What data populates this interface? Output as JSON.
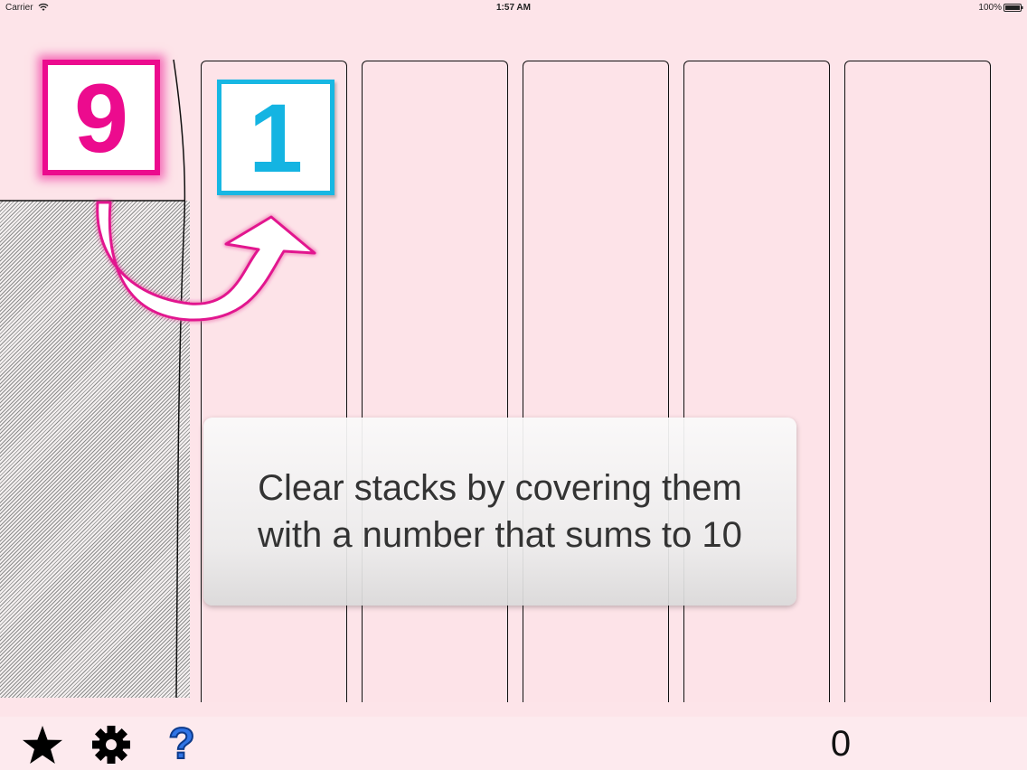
{
  "status_bar": {
    "carrier": "Carrier",
    "time": "1:57 AM",
    "battery": "100%"
  },
  "game": {
    "current_tile": "9",
    "target_tile": "1",
    "stack_count": 5,
    "colors": {
      "current_tile": "#ec0b8e",
      "target_tile": "#17b7e3",
      "background": "#fde4e9"
    }
  },
  "hint": {
    "text": "Clear stacks by covering them with a number that sums to 10"
  },
  "toolbar": {
    "star_icon": "star-icon",
    "settings_icon": "gear-icon",
    "help_icon": "question-icon",
    "help_label": "?",
    "score": "0"
  }
}
